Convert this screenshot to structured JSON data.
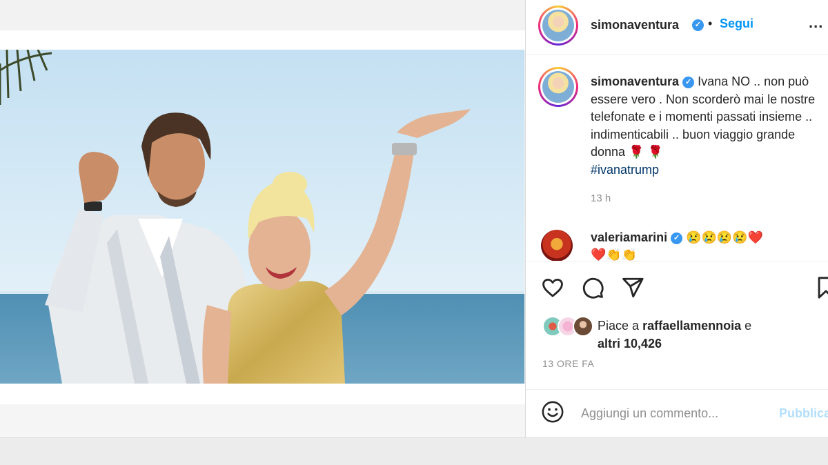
{
  "post": {
    "author": "simonaventura",
    "follow_label": "Segui",
    "separator": "•",
    "more_label": "...",
    "caption_parts": {
      "username": "simonaventura",
      "text": "Ivana NO .. non può essere vero . Non scorderò mai le nostre telefonate e i momenti passati insieme .. indimenticabili .. buon viaggio grande donna",
      "emoji": "🌹 🌹",
      "hashtag": "#ivanatrump"
    },
    "time_ago": "13 h"
  },
  "comment": {
    "username": "valeriamarini",
    "emoji_line1": "😢😢😢😢❤️",
    "emoji_line2": "❤️👏👏"
  },
  "likes": {
    "prefix": "Piace a",
    "user": "raffaellamennoia",
    "connector": "e",
    "others": "altri 10,426"
  },
  "date_label": "13 ORE FA",
  "add_comment": {
    "placeholder": "Aggiungi un commento...",
    "publish_label": "Pubblica"
  },
  "icons": {
    "verified": "verified-badge-icon",
    "like": "heart-icon",
    "comment": "comment-bubble-icon",
    "share": "paper-plane-icon",
    "save": "bookmark-icon",
    "emoji": "smiley-icon"
  },
  "colors": {
    "link_blue": "#0095f6",
    "verified_blue": "#3897f0",
    "muted_gray": "#8e8e8e",
    "hashtag": "#00376b"
  }
}
